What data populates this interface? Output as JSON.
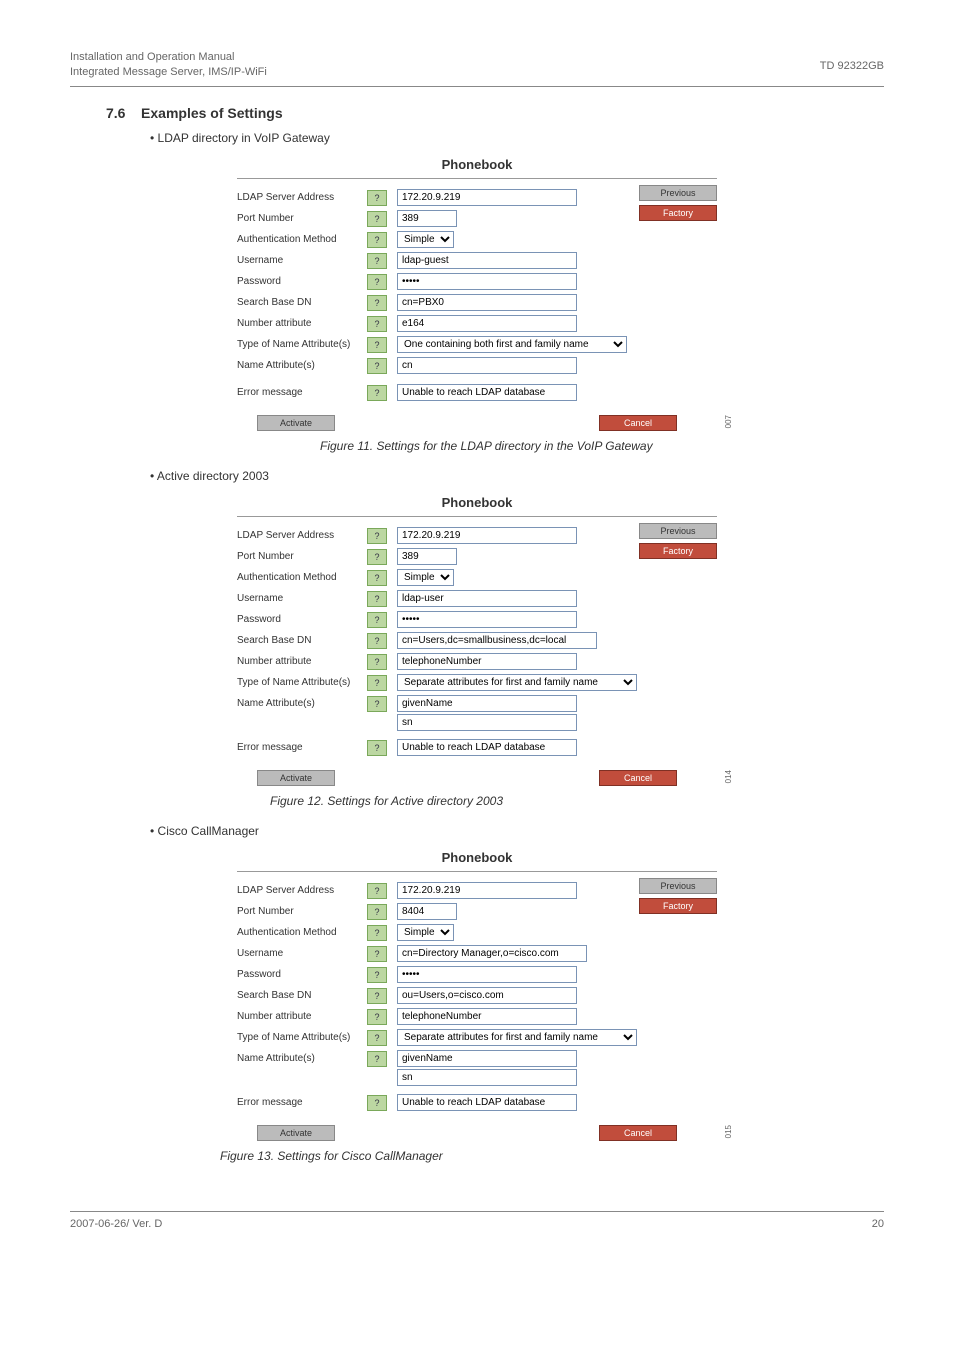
{
  "header": {
    "line1": "Installation and Operation Manual",
    "line2": "Integrated Message Server, IMS/IP-WiFi",
    "right": "TD 92322GB"
  },
  "section": {
    "num": "7.6",
    "title": "Examples of Settings"
  },
  "bullets": {
    "b1": "LDAP directory in VoIP Gateway",
    "b2": "Active directory 2003",
    "b3": "Cisco CallManager"
  },
  "captions": {
    "f11": "Figure 11. Settings for the LDAP directory in the VoIP Gateway",
    "f12": "Figure 12. Settings for Active directory 2003",
    "f13": "Figure 13. Settings for Cisco CallManager"
  },
  "pb": {
    "title": "Phonebook",
    "labels": {
      "server": "LDAP Server Address",
      "port": "Port Number",
      "auth": "Authentication Method",
      "user": "Username",
      "pass": "Password",
      "base": "Search Base DN",
      "numattr": "Number attribute",
      "typename": "Type of Name Attribute(s)",
      "nameattr": "Name Attribute(s)",
      "err": "Error message"
    },
    "help": "?",
    "auth_option": "Simple",
    "buttons": {
      "previous": "Previous",
      "factory": "Factory",
      "activate": "Activate",
      "cancel": "Cancel"
    },
    "err_val": "Unable to reach LDAP database"
  },
  "fig11": {
    "server": "172.20.9.219",
    "port": "389",
    "user": "ldap-guest",
    "pass": "•••••",
    "base": "cn=PBX0",
    "numattr": "e164",
    "typename": "One containing both first and family name",
    "nameattr": "cn",
    "side": "007"
  },
  "fig12": {
    "server": "172.20.9.219",
    "port": "389",
    "user": "ldap-user",
    "pass": "•••••",
    "base": "cn=Users,dc=smallbusiness,dc=local",
    "numattr": "telephoneNumber",
    "typename": "Separate attributes for first and family name",
    "nameattr1": "givenName",
    "nameattr2": "sn",
    "side": "014"
  },
  "fig13": {
    "server": "172.20.9.219",
    "port": "8404",
    "user": "cn=Directory Manager,o=cisco.com",
    "pass": "•••••",
    "base": "ou=Users,o=cisco.com",
    "numattr": "telephoneNumber",
    "typename": "Separate attributes for first and family name",
    "nameattr1": "givenName",
    "nameattr2": "sn",
    "side": "015"
  },
  "footer": {
    "left": "2007-06-26/ Ver. D",
    "right": "20"
  }
}
